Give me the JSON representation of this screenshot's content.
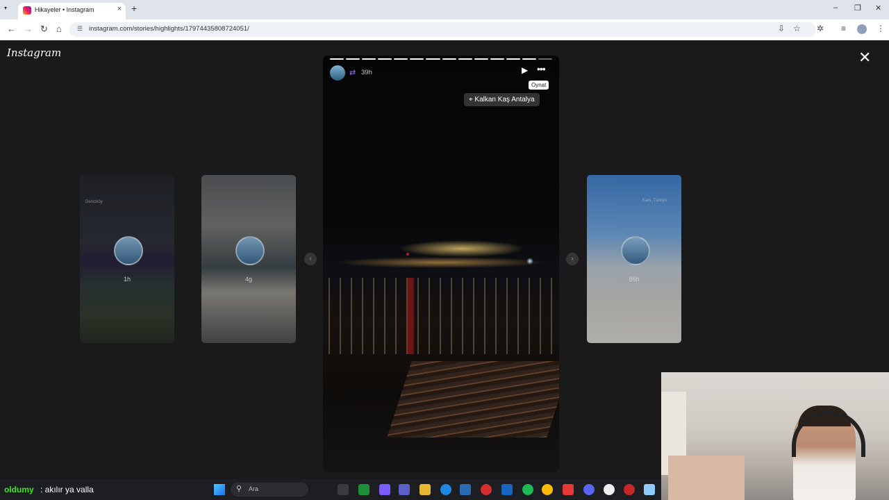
{
  "browser": {
    "tab_title": "Hikayeler • Instagram",
    "url": "instagram.com/stories/highlights/17974435808724051/",
    "new_tab_label": "+"
  },
  "instagram": {
    "logo": "Instagram",
    "close_icon": "close-icon"
  },
  "story": {
    "time": "39h",
    "tooltip": "Oynat",
    "location": "Kalkan Kaş Antalya",
    "segments_total": 14,
    "segments_done": 13
  },
  "thumbnails": [
    {
      "time": "1h",
      "location": "Denizköy"
    },
    {
      "time": "4g",
      "location": ""
    },
    {
      "time": "86h",
      "location": "Kars, Türkiye"
    }
  ],
  "chat": {
    "username": "oldumy",
    "message": ": akılır ya valla"
  },
  "taskbar": {
    "search_label": "Ara"
  }
}
